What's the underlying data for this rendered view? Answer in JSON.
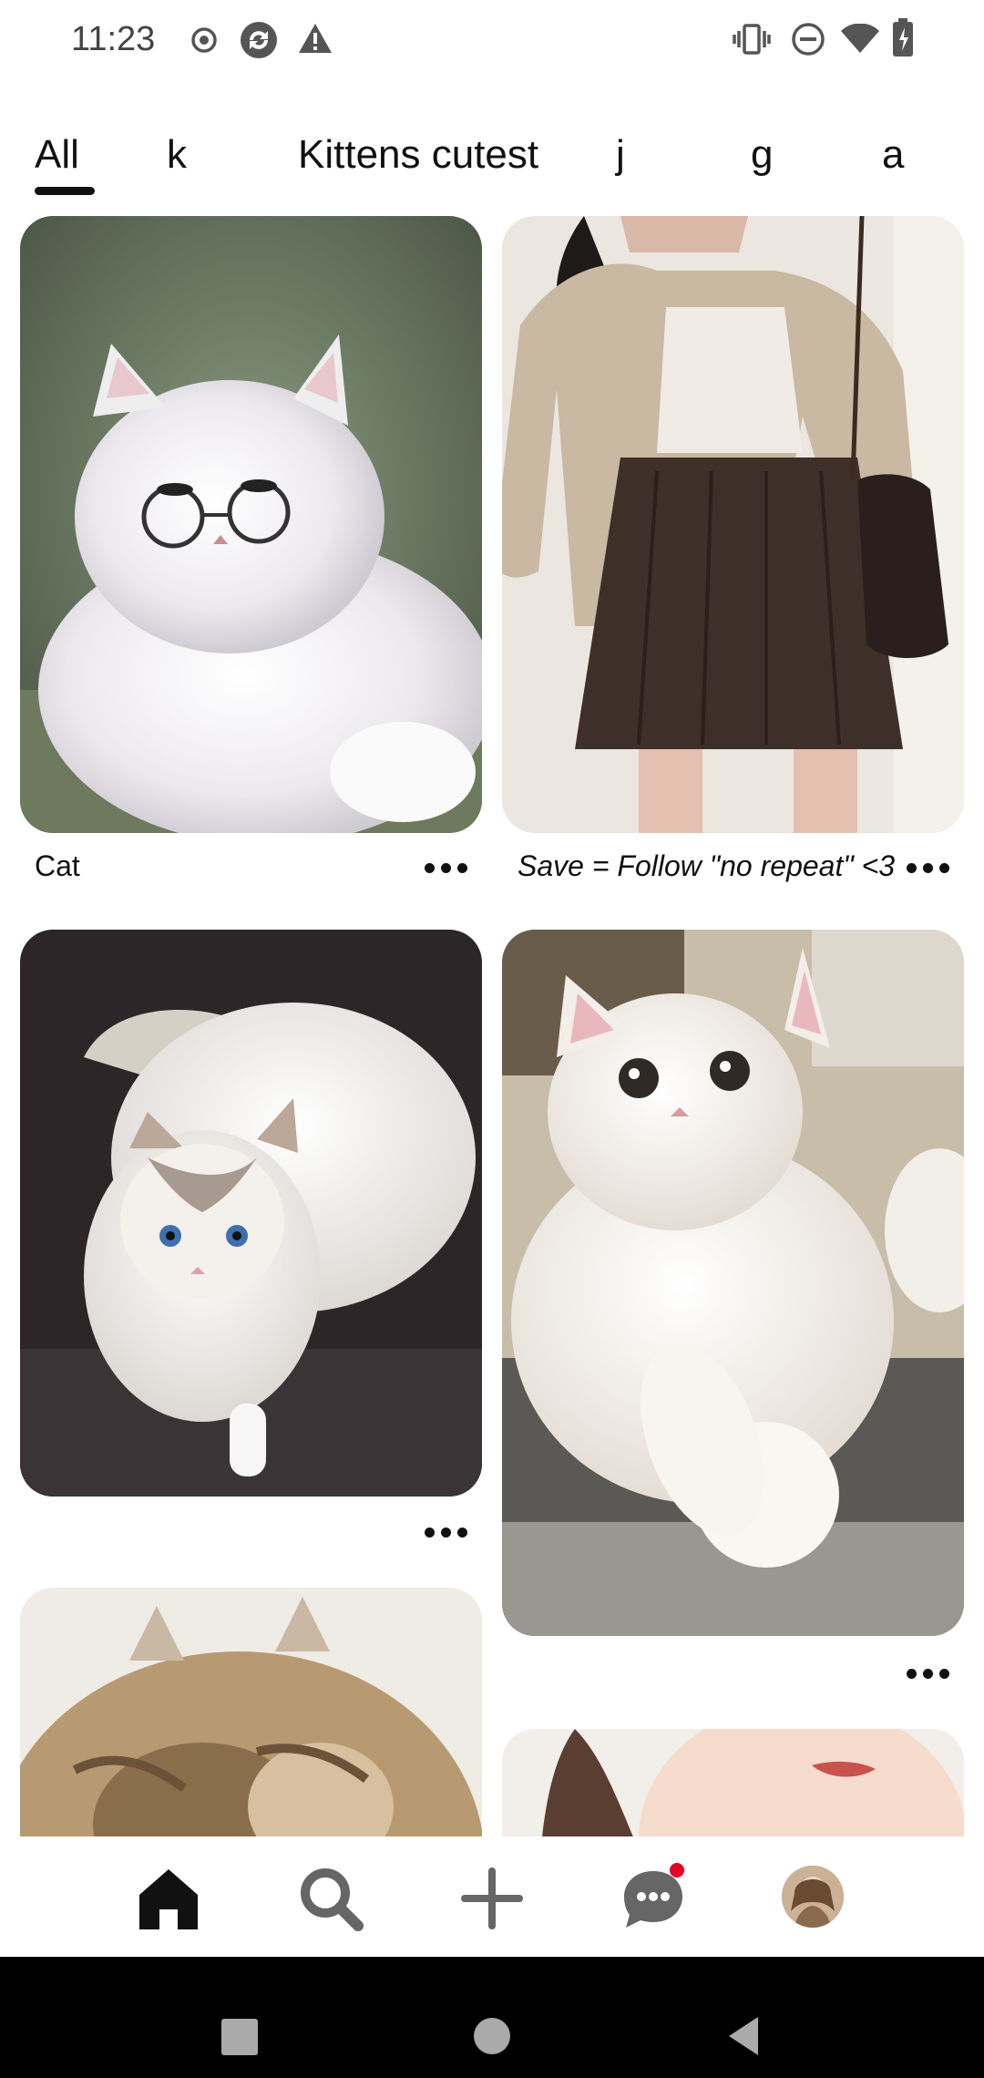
{
  "status_bar": {
    "time": "11:23",
    "left_icons": [
      "record-icon",
      "sync-icon",
      "warning-icon"
    ],
    "right_icons": [
      "vibrate-icon",
      "do-not-disturb-icon",
      "wifi-icon",
      "battery-icon"
    ]
  },
  "tabs": [
    {
      "label": "All",
      "selected": true
    },
    {
      "label": "k",
      "selected": false
    },
    {
      "label": "Kittens cutest",
      "selected": false
    },
    {
      "label": "j",
      "selected": false
    },
    {
      "label": "g",
      "selected": false
    },
    {
      "label": "a",
      "selected": false
    }
  ],
  "pins": [
    {
      "image": "white persian cat wearing glasses",
      "caption": "Cat"
    },
    {
      "image": "person in beige cardigan and brown pleated skirt",
      "caption": "Save = Follow \"no repeat\" <3"
    },
    {
      "image": "white ragdoll cat with blue eyes",
      "caption": ""
    },
    {
      "image": "fluffy white cat lying on granite counter",
      "caption": ""
    },
    {
      "image": "close-up of fluffy tabby kitten",
      "caption": ""
    },
    {
      "image": "portrait of woman",
      "caption": ""
    }
  ],
  "bottom_nav": {
    "items": [
      "home-icon",
      "search-icon",
      "create-icon",
      "messages-icon",
      "profile-avatar"
    ],
    "active": "home-icon",
    "notification_dot_color": "#e60023"
  },
  "system_nav": [
    "recents-button",
    "home-button",
    "back-button"
  ]
}
